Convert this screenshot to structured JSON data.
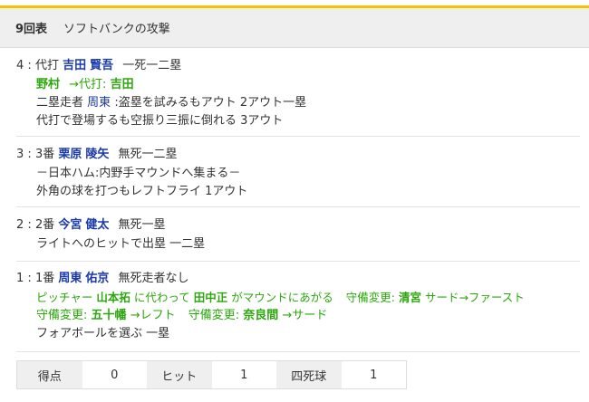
{
  "header": {
    "inning": "9回表",
    "title": "ソフトバンクの攻撃"
  },
  "plays": [
    {
      "number": "4",
      "order": "代打",
      "batter_family": "吉田",
      "batter_given": "賢吾",
      "situation": "一死一二塁",
      "events": [
        {
          "type": "substitution",
          "out_player": "野村",
          "arrow_text": "→代打:",
          "in_player": "吉田"
        },
        {
          "type": "runner",
          "prefix": "二塁走者",
          "runner": "周東",
          "text": ":盗塁を試みるもアウト 2アウト一塁"
        },
        {
          "type": "text",
          "text": "代打で登場するも空振り三振に倒れる 3アウト"
        }
      ]
    },
    {
      "number": "3",
      "order": "3番",
      "batter_family": "栗原",
      "batter_given": "陵矢",
      "situation": "無死一二塁",
      "events": [
        {
          "type": "text",
          "text": "－日本ハム:内野手マウンドへ集まる－"
        },
        {
          "type": "text",
          "text": "外角の球を打つもレフトフライ 1アウト"
        }
      ]
    },
    {
      "number": "2",
      "order": "2番",
      "batter_family": "今宮",
      "batter_given": "健太",
      "situation": "無死一塁",
      "events": [
        {
          "type": "text",
          "text": "ライトへのヒットで出塁 一二塁"
        }
      ]
    },
    {
      "number": "1",
      "order": "1番",
      "batter_family": "周東",
      "batter_given": "佑京",
      "situation": "無死走者なし",
      "events": [
        {
          "type": "pitcher_change",
          "pitcher_label": "ピッチャー",
          "old_pitcher": "山本拓",
          "mid_text": "に代わって",
          "new_pitcher": "田中正",
          "end_text": "がマウンドにあがる",
          "def_label": "守備変更:",
          "def_player": "清宮",
          "def_text": "サード→ファースト"
        },
        {
          "type": "defense_change",
          "def_label1": "守備変更:",
          "def_player1": "五十幡",
          "def_text1": "→レフト",
          "def_label2": "守備変更:",
          "def_player2": "奈良間",
          "def_text2": "→サード"
        },
        {
          "type": "text",
          "text": "フォアボールを選ぶ 一塁"
        }
      ]
    }
  ],
  "stats": {
    "runs_label": "得点",
    "runs": "0",
    "hits_label": "ヒット",
    "hits": "1",
    "walks_label": "四死球",
    "walks": "1"
  }
}
